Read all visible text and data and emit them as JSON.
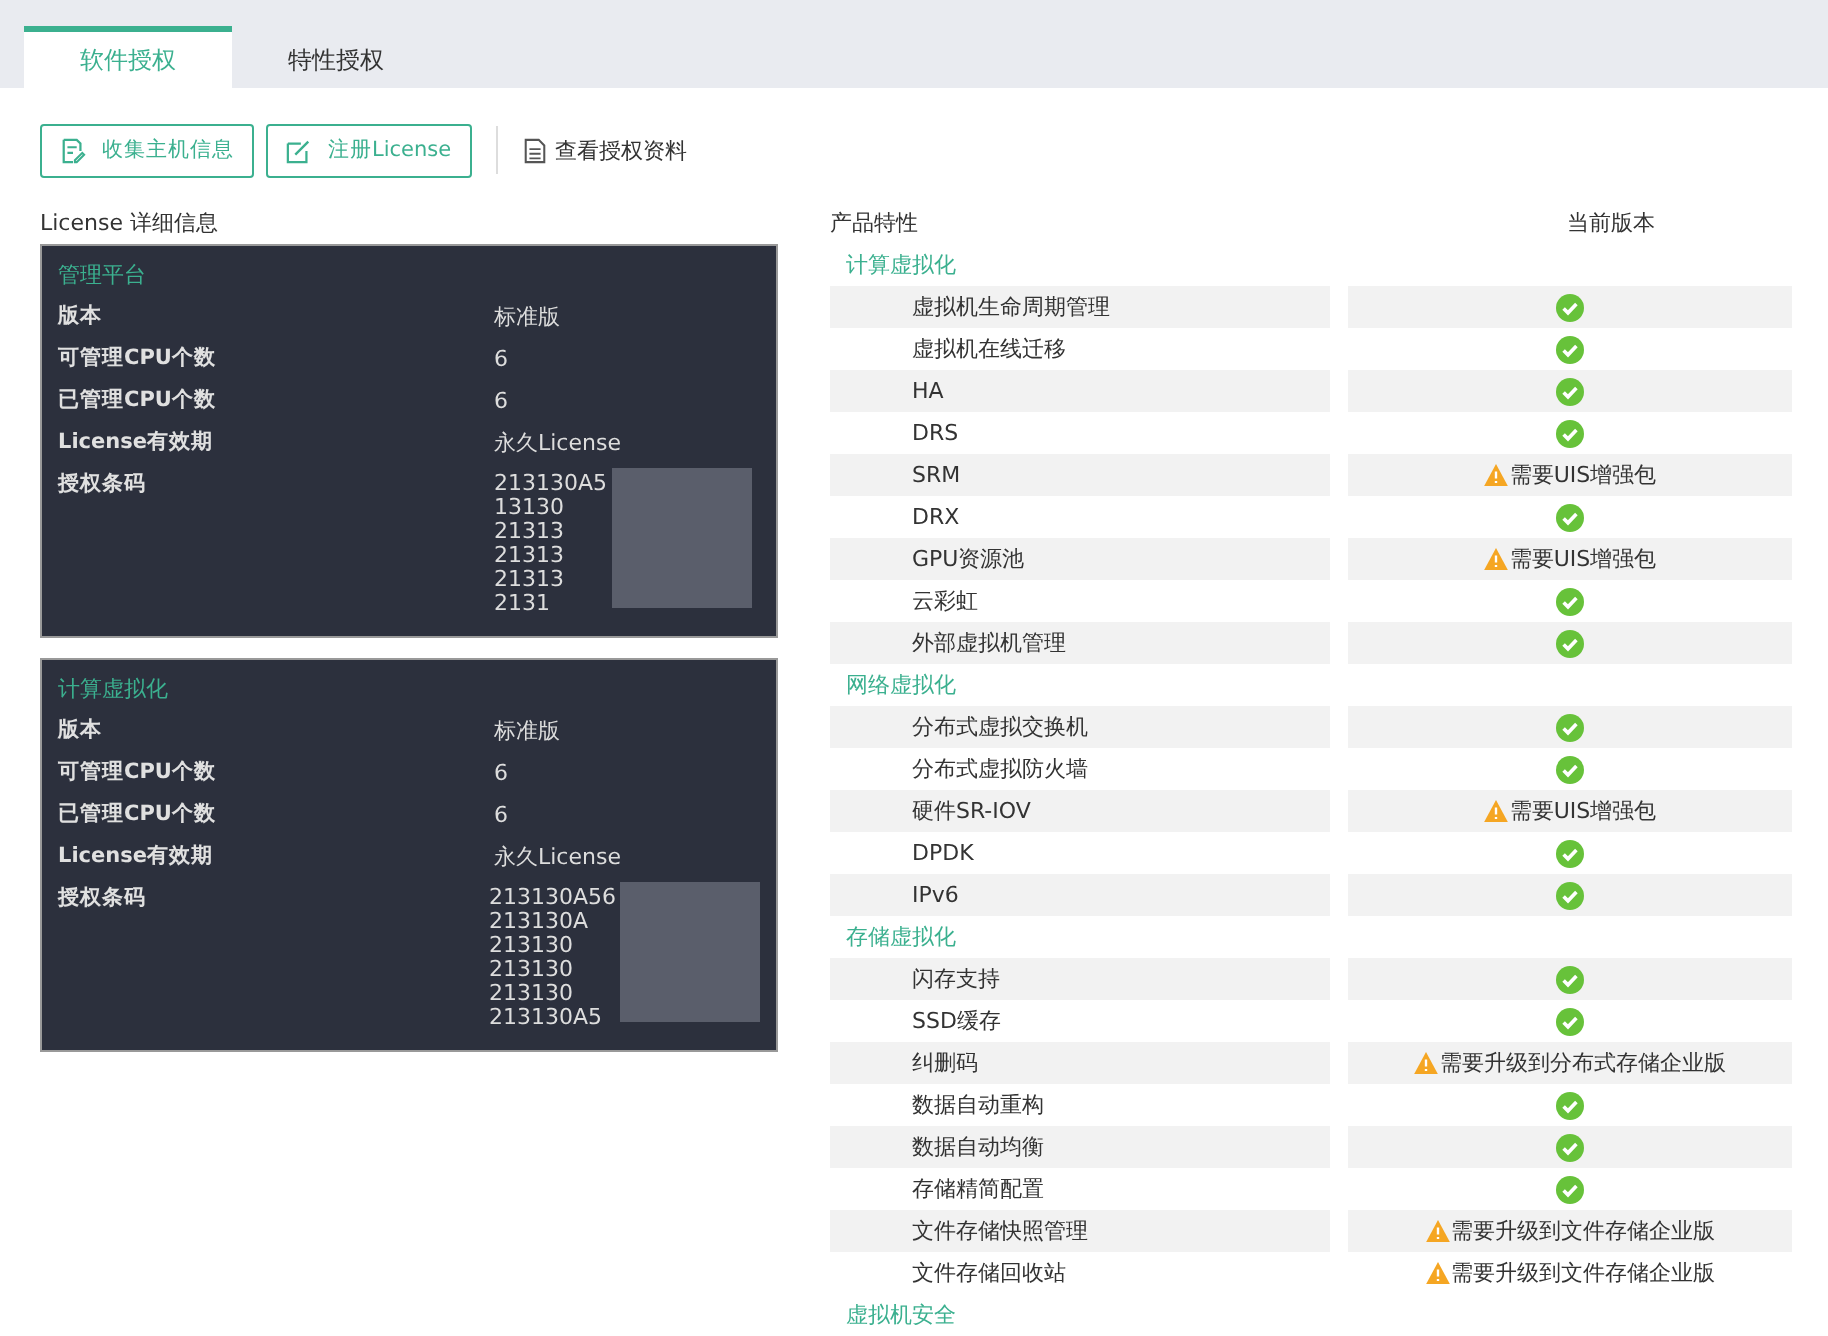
{
  "tabs": [
    {
      "label": "软件授权",
      "selected": true
    },
    {
      "label": "特性授权",
      "selected": false
    }
  ],
  "toolbar": {
    "buttons": [
      {
        "label": "收集主机信息",
        "kind": "collect"
      },
      {
        "label": "注册License",
        "kind": "register"
      }
    ],
    "link": "查看授权资料"
  },
  "license_details": {
    "title": "License 详细信息",
    "panels": [
      {
        "title": "管理平台",
        "rows": [
          {
            "label": "版本",
            "value": "标准版"
          },
          {
            "label": "可管理CPU个数",
            "value": "6"
          },
          {
            "label": "已管理CPU个数",
            "value": "6"
          },
          {
            "label": "License有效期",
            "value": "永久License"
          }
        ],
        "barcode_label": "授权条码",
        "barcode_lines": [
          "213130A5",
          "13130",
          "21313",
          "21313",
          "21313",
          "2131"
        ]
      },
      {
        "title": "计算虚拟化",
        "rows": [
          {
            "label": "版本",
            "value": "标准版"
          },
          {
            "label": "可管理CPU个数",
            "value": "6"
          },
          {
            "label": "已管理CPU个数",
            "value": "6"
          },
          {
            "label": "License有效期",
            "value": "永久License"
          }
        ],
        "barcode_label": "授权条码",
        "barcode_lines": [
          "213130A56",
          "213130A",
          "213130",
          "213130",
          "213130",
          "213130A5"
        ]
      }
    ]
  },
  "features": {
    "columns": [
      "产品特性",
      "当前版本"
    ],
    "groups": [
      {
        "title": "计算虚拟化",
        "items": [
          {
            "name": "虚拟机生命周期管理",
            "kind": "ok"
          },
          {
            "name": "虚拟机在线迁移",
            "kind": "ok"
          },
          {
            "name": "HA",
            "kind": "ok"
          },
          {
            "name": "DRS",
            "kind": "ok"
          },
          {
            "name": "SRM",
            "kind": "warning",
            "note": "需要UIS增强包"
          },
          {
            "name": "DRX",
            "kind": "ok"
          },
          {
            "name": "GPU资源池",
            "kind": "warning",
            "note": "需要UIS增强包"
          },
          {
            "name": "云彩虹",
            "kind": "ok"
          },
          {
            "name": "外部虚拟机管理",
            "kind": "ok"
          }
        ]
      },
      {
        "title": "网络虚拟化",
        "items": [
          {
            "name": "分布式虚拟交换机",
            "kind": "ok"
          },
          {
            "name": "分布式虚拟防火墙",
            "kind": "ok"
          },
          {
            "name": "硬件SR-IOV",
            "kind": "warning",
            "note": "需要UIS增强包"
          },
          {
            "name": "DPDK",
            "kind": "ok"
          },
          {
            "name": "IPv6",
            "kind": "ok"
          }
        ]
      },
      {
        "title": "存储虚拟化",
        "items": [
          {
            "name": "闪存支持",
            "kind": "ok"
          },
          {
            "name": "SSD缓存",
            "kind": "ok"
          },
          {
            "name": "纠删码",
            "kind": "warning",
            "note": "需要升级到分布式存储企业版"
          },
          {
            "name": "数据自动重构",
            "kind": "ok"
          },
          {
            "name": "数据自动均衡",
            "kind": "ok"
          },
          {
            "name": "存储精简配置",
            "kind": "ok"
          },
          {
            "name": "文件存储快照管理",
            "kind": "warning",
            "note": "需要升级到文件存储企业版"
          },
          {
            "name": "文件存储回收站",
            "kind": "warning",
            "note": "需要升级到文件存储企业版"
          }
        ]
      },
      {
        "title": "虚拟机安全"
      }
    ]
  }
}
